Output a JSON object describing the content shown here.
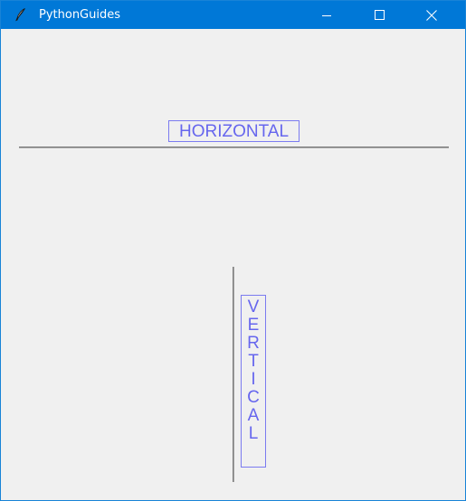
{
  "window": {
    "title": "PythonGuides",
    "icon": "feather-icon",
    "titlebar_color": "#0078d7",
    "controls": {
      "minimize": "minimize-icon",
      "maximize": "maximize-icon",
      "close": "close-icon"
    }
  },
  "content": {
    "horizontal_label": "HORIZONTAL",
    "vertical_label": "V\nE\nR\nT\nI\nC\nA\nL",
    "label_color": "#6666ee",
    "separator_color": "#a0a0a0"
  }
}
